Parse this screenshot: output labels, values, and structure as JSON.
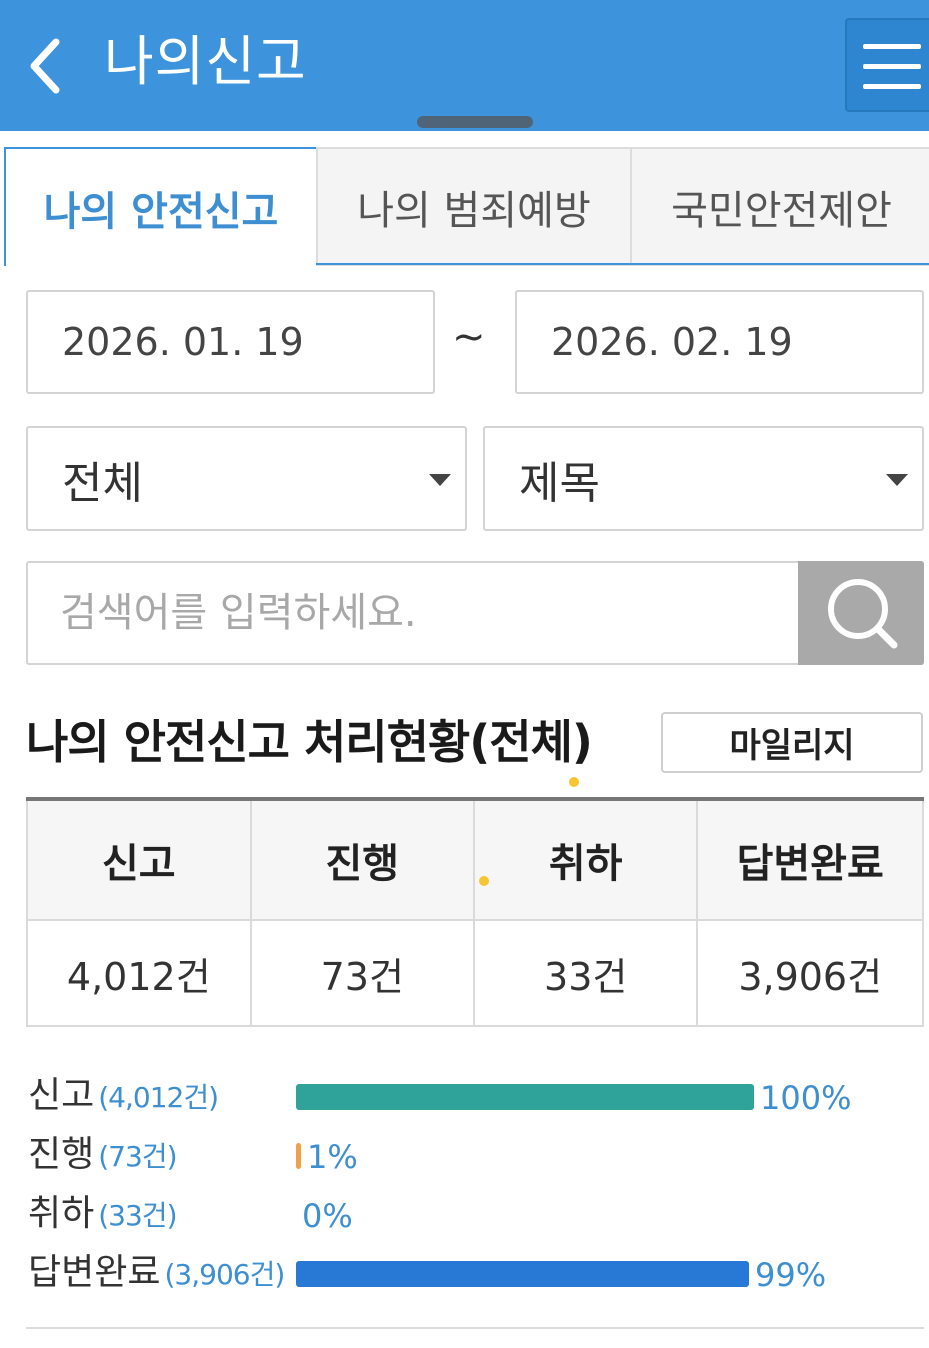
{
  "header": {
    "title": "나의신고",
    "back_icon": "chevron-left-icon",
    "menu_icon": "hamburger-menu-icon",
    "background": "#3d94dc"
  },
  "tabs": [
    {
      "label": "나의 안전신고",
      "active": true
    },
    {
      "label": "나의 범죄예방",
      "active": false
    },
    {
      "label": "국민안전제안",
      "active": false
    }
  ],
  "filters": {
    "start_date": "2026. 01. 19",
    "separator": "~",
    "end_date": "2026. 02. 19",
    "category_select": "전체",
    "field_select": "제목",
    "search_placeholder": "검색어를 입력하세요.",
    "search_icon": "search-icon"
  },
  "summary": {
    "title": "나의 안전신고 처리현황(전체)",
    "mileage_button": "마일리지",
    "columns": [
      "신고",
      "진행",
      "취하",
      "답변완료"
    ],
    "values": [
      "4,012건",
      "73건",
      "33건",
      "3,906건"
    ]
  },
  "progress": [
    {
      "label": "신고",
      "count": "(4,012건)",
      "percent_label": "100%",
      "percent": 100,
      "color": "#2fa39a"
    },
    {
      "label": "진행",
      "count": "(73건)",
      "percent_label": "1%",
      "percent": 1,
      "color": "#f0a04b"
    },
    {
      "label": "취하",
      "count": "(33건)",
      "percent_label": "0%",
      "percent": 0,
      "color": "#999999"
    },
    {
      "label": "답변완료",
      "count": "(3,906건)",
      "percent_label": "99%",
      "percent": 99,
      "color": "#2878d6"
    }
  ]
}
